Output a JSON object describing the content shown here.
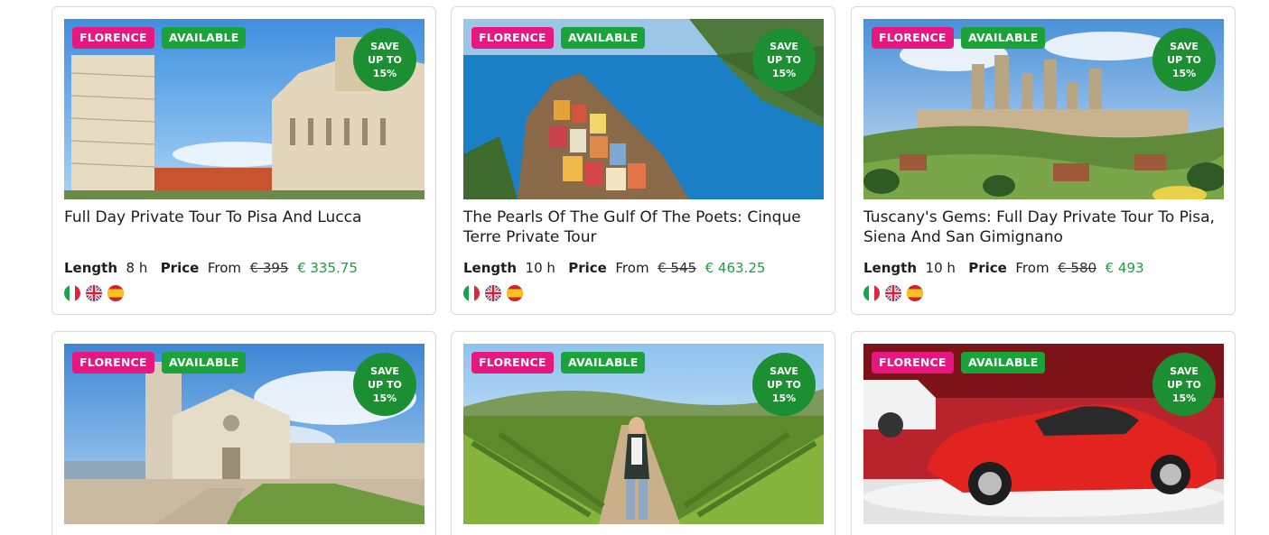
{
  "cards": [
    {
      "image": "pisa-tower-cathedral-photo",
      "city_tag": "FLORENCE",
      "status_tag": "AVAILABLE",
      "save_lines": [
        "SAVE",
        "UP TO",
        "15%"
      ],
      "title": "Full Day Private Tour To Pisa And Lucca",
      "length_label": "Length",
      "length_value": "8 h",
      "price_label": "Price",
      "from_label": "From",
      "old_price": "€ 395",
      "new_price": "€ 335.75",
      "languages": [
        "italian-flag-icon",
        "uk-flag-icon",
        "spanish-flag-icon"
      ]
    },
    {
      "image": "cinque-terre-village-photo",
      "city_tag": "FLORENCE",
      "status_tag": "AVAILABLE",
      "save_lines": [
        "SAVE",
        "UP TO",
        "15%"
      ],
      "title": "The Pearls Of The Gulf Of The Poets: Cinque Terre Private Tour",
      "length_label": "Length",
      "length_value": "10 h",
      "price_label": "Price",
      "from_label": "From",
      "old_price": "€ 545",
      "new_price": "€ 463.25",
      "languages": [
        "italian-flag-icon",
        "uk-flag-icon",
        "spanish-flag-icon"
      ]
    },
    {
      "image": "san-gimignano-towers-photo",
      "city_tag": "FLORENCE",
      "status_tag": "AVAILABLE",
      "save_lines": [
        "SAVE",
        "UP TO",
        "15%"
      ],
      "title": "Tuscany's Gems: Full Day Private Tour To Pisa, Siena And San Gimignano",
      "length_label": "Length",
      "length_value": "10 h",
      "price_label": "Price",
      "from_label": "From",
      "old_price": "€ 580",
      "new_price": "€ 493",
      "languages": [
        "italian-flag-icon",
        "uk-flag-icon",
        "spanish-flag-icon"
      ]
    },
    {
      "image": "assisi-basilica-photo",
      "city_tag": "FLORENCE",
      "status_tag": "AVAILABLE",
      "save_lines": [
        "SAVE",
        "UP TO",
        "15%"
      ]
    },
    {
      "image": "vineyard-walk-photo",
      "city_tag": "FLORENCE",
      "status_tag": "AVAILABLE",
      "save_lines": [
        "SAVE",
        "UP TO",
        "15%"
      ]
    },
    {
      "image": "red-ferrari-photo",
      "city_tag": "FLORENCE",
      "status_tag": "AVAILABLE",
      "save_lines": [
        "SAVE",
        "UP TO",
        "15%"
      ]
    }
  ],
  "colors": {
    "city_tag": "#e6177f",
    "status_tag": "#1ba33a",
    "save_badge": "#1c8f32",
    "discount_price": "#1ba33a"
  }
}
